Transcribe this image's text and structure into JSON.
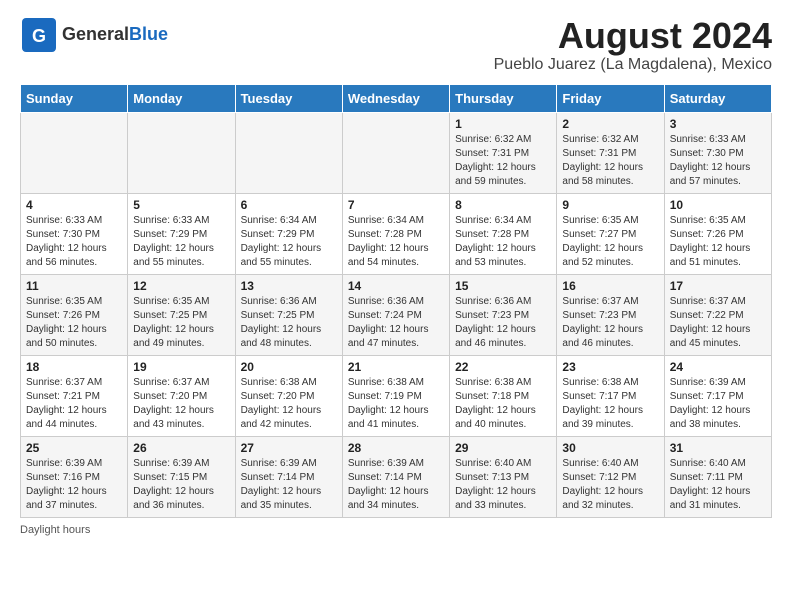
{
  "logo": {
    "general": "General",
    "blue": "Blue"
  },
  "title": "August 2024",
  "subtitle": "Pueblo Juarez (La Magdalena), Mexico",
  "days_of_week": [
    "Sunday",
    "Monday",
    "Tuesday",
    "Wednesday",
    "Thursday",
    "Friday",
    "Saturday"
  ],
  "footer": {
    "label": "Daylight hours"
  },
  "weeks": [
    [
      {
        "day": "",
        "info": ""
      },
      {
        "day": "",
        "info": ""
      },
      {
        "day": "",
        "info": ""
      },
      {
        "day": "",
        "info": ""
      },
      {
        "day": "1",
        "info": "Sunrise: 6:32 AM\nSunset: 7:31 PM\nDaylight: 12 hours and 59 minutes."
      },
      {
        "day": "2",
        "info": "Sunrise: 6:32 AM\nSunset: 7:31 PM\nDaylight: 12 hours and 58 minutes."
      },
      {
        "day": "3",
        "info": "Sunrise: 6:33 AM\nSunset: 7:30 PM\nDaylight: 12 hours and 57 minutes."
      }
    ],
    [
      {
        "day": "4",
        "info": "Sunrise: 6:33 AM\nSunset: 7:30 PM\nDaylight: 12 hours and 56 minutes."
      },
      {
        "day": "5",
        "info": "Sunrise: 6:33 AM\nSunset: 7:29 PM\nDaylight: 12 hours and 55 minutes."
      },
      {
        "day": "6",
        "info": "Sunrise: 6:34 AM\nSunset: 7:29 PM\nDaylight: 12 hours and 55 minutes."
      },
      {
        "day": "7",
        "info": "Sunrise: 6:34 AM\nSunset: 7:28 PM\nDaylight: 12 hours and 54 minutes."
      },
      {
        "day": "8",
        "info": "Sunrise: 6:34 AM\nSunset: 7:28 PM\nDaylight: 12 hours and 53 minutes."
      },
      {
        "day": "9",
        "info": "Sunrise: 6:35 AM\nSunset: 7:27 PM\nDaylight: 12 hours and 52 minutes."
      },
      {
        "day": "10",
        "info": "Sunrise: 6:35 AM\nSunset: 7:26 PM\nDaylight: 12 hours and 51 minutes."
      }
    ],
    [
      {
        "day": "11",
        "info": "Sunrise: 6:35 AM\nSunset: 7:26 PM\nDaylight: 12 hours and 50 minutes."
      },
      {
        "day": "12",
        "info": "Sunrise: 6:35 AM\nSunset: 7:25 PM\nDaylight: 12 hours and 49 minutes."
      },
      {
        "day": "13",
        "info": "Sunrise: 6:36 AM\nSunset: 7:25 PM\nDaylight: 12 hours and 48 minutes."
      },
      {
        "day": "14",
        "info": "Sunrise: 6:36 AM\nSunset: 7:24 PM\nDaylight: 12 hours and 47 minutes."
      },
      {
        "day": "15",
        "info": "Sunrise: 6:36 AM\nSunset: 7:23 PM\nDaylight: 12 hours and 46 minutes."
      },
      {
        "day": "16",
        "info": "Sunrise: 6:37 AM\nSunset: 7:23 PM\nDaylight: 12 hours and 46 minutes."
      },
      {
        "day": "17",
        "info": "Sunrise: 6:37 AM\nSunset: 7:22 PM\nDaylight: 12 hours and 45 minutes."
      }
    ],
    [
      {
        "day": "18",
        "info": "Sunrise: 6:37 AM\nSunset: 7:21 PM\nDaylight: 12 hours and 44 minutes."
      },
      {
        "day": "19",
        "info": "Sunrise: 6:37 AM\nSunset: 7:20 PM\nDaylight: 12 hours and 43 minutes."
      },
      {
        "day": "20",
        "info": "Sunrise: 6:38 AM\nSunset: 7:20 PM\nDaylight: 12 hours and 42 minutes."
      },
      {
        "day": "21",
        "info": "Sunrise: 6:38 AM\nSunset: 7:19 PM\nDaylight: 12 hours and 41 minutes."
      },
      {
        "day": "22",
        "info": "Sunrise: 6:38 AM\nSunset: 7:18 PM\nDaylight: 12 hours and 40 minutes."
      },
      {
        "day": "23",
        "info": "Sunrise: 6:38 AM\nSunset: 7:17 PM\nDaylight: 12 hours and 39 minutes."
      },
      {
        "day": "24",
        "info": "Sunrise: 6:39 AM\nSunset: 7:17 PM\nDaylight: 12 hours and 38 minutes."
      }
    ],
    [
      {
        "day": "25",
        "info": "Sunrise: 6:39 AM\nSunset: 7:16 PM\nDaylight: 12 hours and 37 minutes."
      },
      {
        "day": "26",
        "info": "Sunrise: 6:39 AM\nSunset: 7:15 PM\nDaylight: 12 hours and 36 minutes."
      },
      {
        "day": "27",
        "info": "Sunrise: 6:39 AM\nSunset: 7:14 PM\nDaylight: 12 hours and 35 minutes."
      },
      {
        "day": "28",
        "info": "Sunrise: 6:39 AM\nSunset: 7:14 PM\nDaylight: 12 hours and 34 minutes."
      },
      {
        "day": "29",
        "info": "Sunrise: 6:40 AM\nSunset: 7:13 PM\nDaylight: 12 hours and 33 minutes."
      },
      {
        "day": "30",
        "info": "Sunrise: 6:40 AM\nSunset: 7:12 PM\nDaylight: 12 hours and 32 minutes."
      },
      {
        "day": "31",
        "info": "Sunrise: 6:40 AM\nSunset: 7:11 PM\nDaylight: 12 hours and 31 minutes."
      }
    ]
  ]
}
